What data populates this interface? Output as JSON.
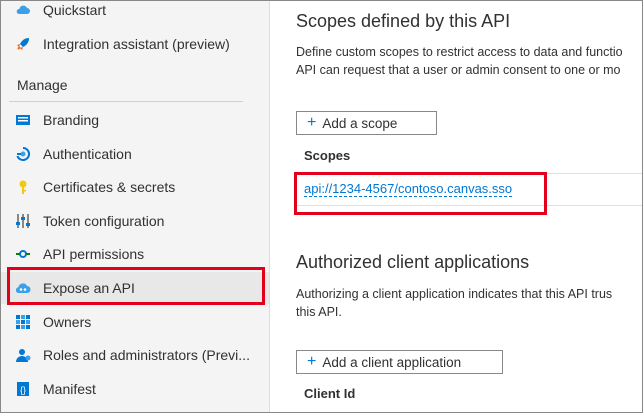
{
  "sidebar": {
    "section_header": "Manage",
    "items": [
      {
        "label": "Quickstart",
        "icon": "cloud-icon"
      },
      {
        "label": "Integration assistant (preview)",
        "icon": "rocket-icon"
      },
      {
        "label": "Branding",
        "icon": "branding-icon"
      },
      {
        "label": "Authentication",
        "icon": "authentication-icon"
      },
      {
        "label": "Certificates & secrets",
        "icon": "key-icon"
      },
      {
        "label": "Token configuration",
        "icon": "token-config-icon"
      },
      {
        "label": "API permissions",
        "icon": "api-permissions-icon"
      },
      {
        "label": "Expose an API",
        "icon": "expose-api-icon",
        "selected": true
      },
      {
        "label": "Owners",
        "icon": "owners-icon"
      },
      {
        "label": "Roles and administrators (Previ...",
        "icon": "roles-icon"
      },
      {
        "label": "Manifest",
        "icon": "manifest-icon"
      }
    ]
  },
  "main": {
    "scopes": {
      "title": "Scopes defined by this API",
      "description_line1": "Define custom scopes to restrict access to data and functio",
      "description_line2": "API can request that a user or admin consent to one or mo",
      "add_button": "Add a scope",
      "column_header": "Scopes",
      "rows": [
        {
          "value": "api://1234-4567/contoso.canvas.sso"
        }
      ]
    },
    "authorized": {
      "title": "Authorized client applications",
      "description_line1": "Authorizing a client application indicates that this API trus",
      "description_line2": "this API.",
      "add_button": "Add a client application",
      "column_header": "Client Id"
    }
  },
  "colors": {
    "accent": "#0078d4",
    "highlight": "#e3001b",
    "sidebar_bg": "#f4f4f4",
    "selected_bg": "#e8e8e8"
  }
}
